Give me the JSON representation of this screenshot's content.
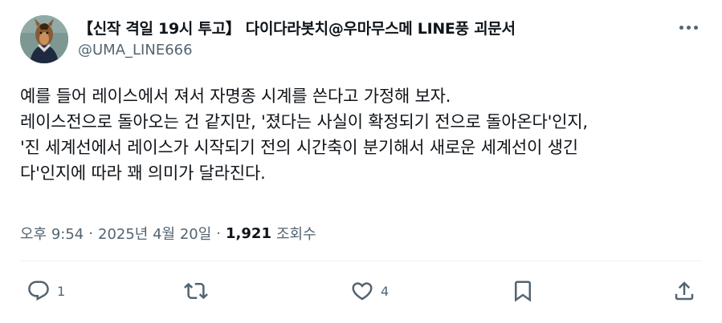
{
  "author": {
    "display_name": "【신작 격일 19시 투고】 다이다라봇치@우마무스메 LINE풍 괴문서",
    "handle": "@UMA_LINE666",
    "avatar_icon": "avatar-horse-girl-image"
  },
  "more_icon": "more-horizontal-icon",
  "tweet": {
    "lines": [
      "예를 들어 레이스에서 져서 자명종 시계를 쓴다고 가정해 보자.",
      "레이스전으로 돌아오는 건 같지만, '졌다는 사실이 확정되기 전으로 돌아온다'인지,",
      "'진 세계선에서 레이스가 시작되기 전의 시간축이 분기해서 새로운 세계선이 생긴",
      "다'인지에 따라 꽤 의미가 달라진다."
    ]
  },
  "meta": {
    "time": "오후 9:54",
    "separator": "·",
    "date": "2025년 4월 20일",
    "views_count": "1,921",
    "views_label": "조회수"
  },
  "actions": {
    "reply": {
      "icon": "reply-icon",
      "count": "1"
    },
    "retweet": {
      "icon": "retweet-icon",
      "count": ""
    },
    "like": {
      "icon": "heart-icon",
      "count": "4"
    },
    "bookmark": {
      "icon": "bookmark-icon"
    },
    "share": {
      "icon": "share-icon"
    }
  },
  "colors": {
    "text": "#0f1419",
    "secondary": "#536471",
    "divider": "#eff3f4"
  }
}
